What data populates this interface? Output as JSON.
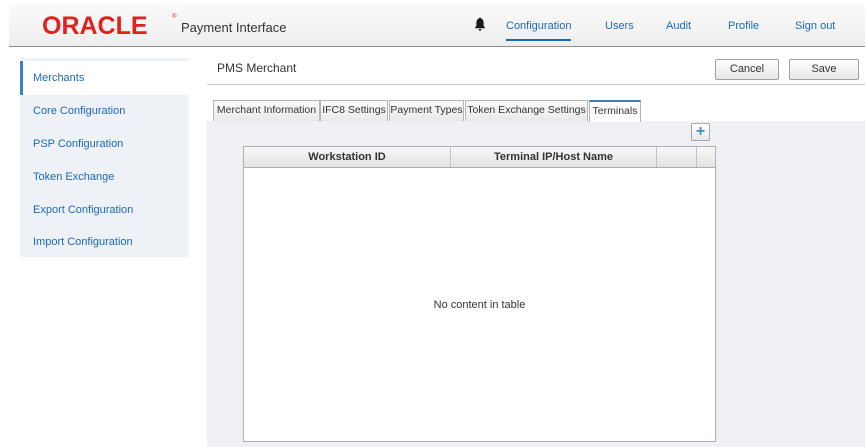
{
  "header": {
    "logo": "ORACLE",
    "logo_reg": "®",
    "app_title": "Payment Interface",
    "nav": [
      {
        "label": "Configuration"
      },
      {
        "label": "Users"
      },
      {
        "label": "Audit"
      },
      {
        "label": "Profile"
      },
      {
        "label": "Sign out"
      }
    ],
    "active_nav": "Configuration",
    "notification_icon": "bell-icon"
  },
  "sidebar": {
    "items": [
      {
        "label": "Merchants"
      },
      {
        "label": "Core Configuration"
      },
      {
        "label": "PSP Configuration"
      },
      {
        "label": "Token Exchange"
      },
      {
        "label": "Export Configuration"
      },
      {
        "label": "Import Configuration"
      }
    ],
    "active": "Merchants"
  },
  "main": {
    "title": "PMS Merchant",
    "buttons": {
      "cancel": "Cancel",
      "save": "Save"
    },
    "tabs": [
      {
        "label": "Merchant Information"
      },
      {
        "label": "IFC8 Settings"
      },
      {
        "label": "Payment Types"
      },
      {
        "label": "Token Exchange Settings"
      },
      {
        "label": "Terminals"
      }
    ],
    "active_tab": "Terminals",
    "add_icon": "plus-icon",
    "table": {
      "columns": [
        "Workstation ID",
        "Terminal IP/Host Name"
      ],
      "empty_message": "No content in table"
    }
  },
  "colors": {
    "brand": "#e2211c",
    "accent": "#1a6ab8",
    "sidebar_bg": "#eef1f5"
  }
}
